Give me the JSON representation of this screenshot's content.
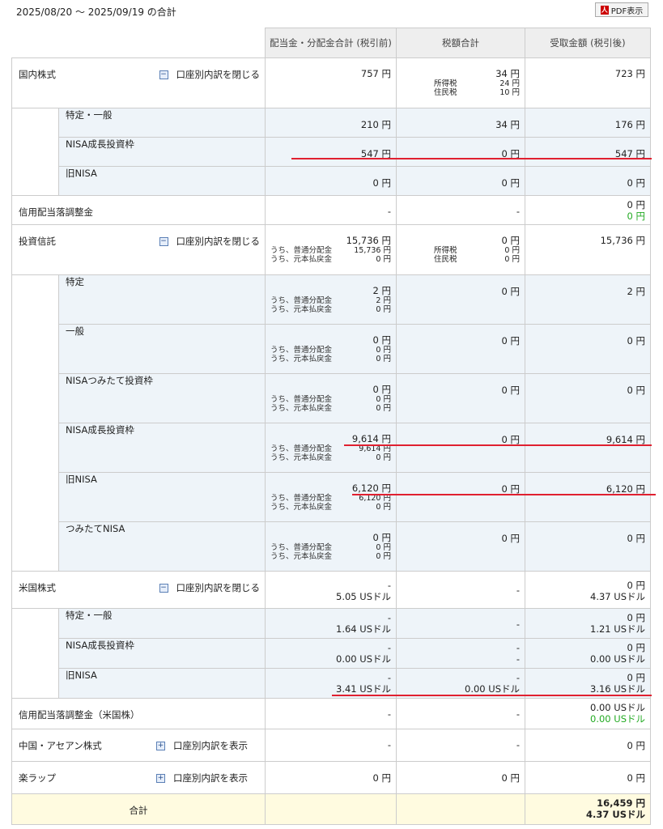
{
  "header": {
    "period": "2025/08/20 ～ 2025/09/19 の合計",
    "pdf_label": "PDF表示",
    "pdf_icon_glyph": "人"
  },
  "columns": {
    "dividend": "配当金・分配金合計 (税引前)",
    "tax": "税額合計",
    "received": "受取金額 (税引後)"
  },
  "labels": {
    "close_breakdown": "口座別内訳を閉じる",
    "show_breakdown": "口座別内訳を表示",
    "income_tax": "所得税",
    "resident_tax": "住民税",
    "ordinary": "うち、普通分配金",
    "principal": "うち、元本払戻金",
    "toggle_minus": "−",
    "toggle_plus": "+"
  },
  "domestic": {
    "label": "国内株式",
    "dividend": "757 円",
    "tax": "34 円",
    "income_tax": "24 円",
    "resident_tax": "10 円",
    "received": "723 円",
    "sub": [
      {
        "label": "特定・一般",
        "dividend": "210 円",
        "tax": "34 円",
        "received": "176 円"
      },
      {
        "label": "NISA成長投資枠",
        "dividend": "547 円",
        "tax": "0 円",
        "received": "547 円"
      },
      {
        "label": "旧NISA",
        "dividend": "0 円",
        "tax": "0 円",
        "received": "0 円"
      }
    ]
  },
  "margin_adj": {
    "label": "信用配当落調整金",
    "dividend": "-",
    "tax": "-",
    "received": "0 円",
    "received_green": "0 円"
  },
  "fund": {
    "label": "投資信託",
    "dividend": "15,736 円",
    "ordinary": "15,736 円",
    "principal": "0 円",
    "tax": "0 円",
    "income_tax": "0 円",
    "resident_tax": "0 円",
    "received": "15,736 円",
    "sub": [
      {
        "label": "特定",
        "dividend": "2 円",
        "ordinary": "2 円",
        "principal": "0 円",
        "tax": "0 円",
        "received": "2 円"
      },
      {
        "label": "一般",
        "dividend": "0 円",
        "ordinary": "0 円",
        "principal": "0 円",
        "tax": "0 円",
        "received": "0 円"
      },
      {
        "label": "NISAつみたて投資枠",
        "dividend": "0 円",
        "ordinary": "0 円",
        "principal": "0 円",
        "tax": "0 円",
        "received": "0 円"
      },
      {
        "label": "NISA成長投資枠",
        "dividend": "9,614 円",
        "ordinary": "9,614 円",
        "principal": "0 円",
        "tax": "0 円",
        "received": "9,614 円"
      },
      {
        "label": "旧NISA",
        "dividend": "6,120 円",
        "ordinary": "6,120 円",
        "principal": "0 円",
        "tax": "0 円",
        "received": "6,120 円"
      },
      {
        "label": "つみたてNISA",
        "dividend": "0 円",
        "ordinary": "0 円",
        "principal": "0 円",
        "tax": "0 円",
        "received": "0 円"
      }
    ]
  },
  "us": {
    "label": "米国株式",
    "dividend_jpy": "-",
    "dividend_usd": "5.05 USドル",
    "tax": "-",
    "received_jpy": "0 円",
    "received_usd": "4.37 USドル",
    "sub": [
      {
        "label": "特定・一般",
        "dividend_jpy": "-",
        "dividend_usd": "1.64 USドル",
        "tax": "-",
        "received_jpy": "0 円",
        "received_usd": "1.21 USドル"
      },
      {
        "label": "NISA成長投資枠",
        "dividend_jpy": "-",
        "dividend_usd": "0.00 USドル",
        "tax_jpy": "-",
        "tax_usd": "-",
        "received_jpy": "0 円",
        "received_usd": "0.00 USドル"
      },
      {
        "label": "旧NISA",
        "dividend_jpy": "-",
        "dividend_usd": "3.41 USドル",
        "tax_jpy": "-",
        "tax_usd": "0.00 USドル",
        "received_jpy": "0 円",
        "received_usd": "3.16 USドル"
      }
    ]
  },
  "us_margin": {
    "label": "信用配当落調整金（米国株）",
    "dividend": "-",
    "tax": "-",
    "received": "0.00 USドル",
    "received_green": "0.00 USドル"
  },
  "asean": {
    "label": "中国・アセアン株式",
    "dividend": "-",
    "tax": "-",
    "received": "0 円"
  },
  "wrap": {
    "label": "楽ラップ",
    "dividend": "0 円",
    "tax": "0 円",
    "received": "0 円"
  },
  "total": {
    "label": "合計",
    "received_jpy": "16,459 円",
    "received_usd": "4.37 USドル"
  },
  "colors": {
    "highlight_line": "#e02030",
    "green": "#22aa22",
    "sub_bg": "#eef4f9",
    "total_bg": "#fffbe0"
  }
}
